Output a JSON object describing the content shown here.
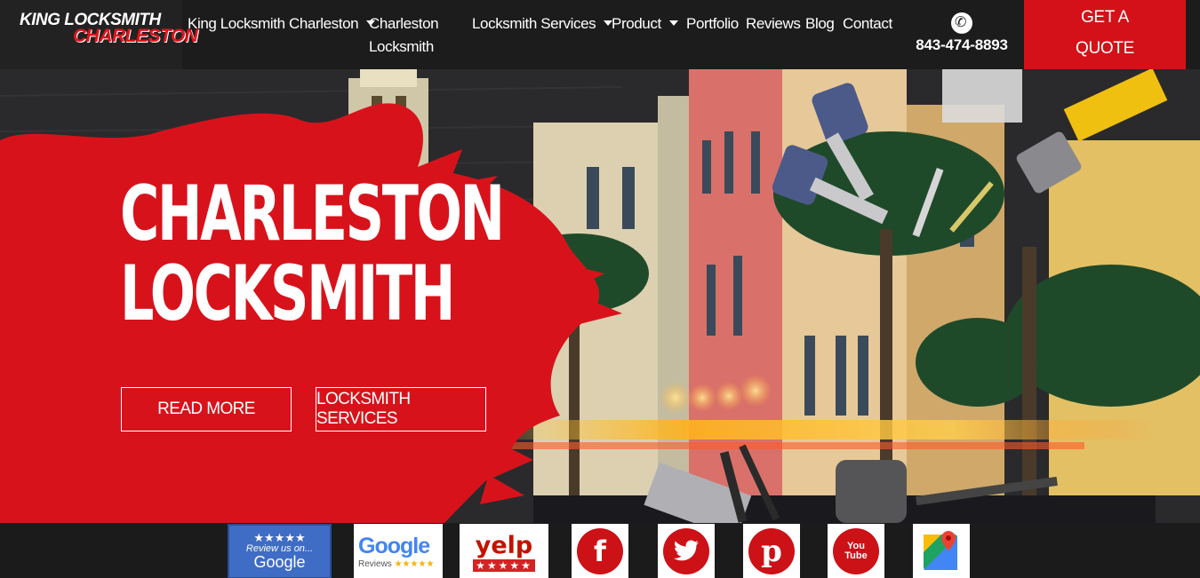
{
  "brand": {
    "line1": "King Locksmith",
    "line2": "Charleston"
  },
  "nav": [
    {
      "label": "King Locksmith Charleston",
      "dropdown": true
    },
    {
      "label": "Charleston",
      "label2": "Locksmith",
      "dropdown": false
    },
    {
      "label": "Locksmith Services",
      "dropdown": true
    },
    {
      "label": "Product",
      "dropdown": true
    },
    {
      "label": "Portfolio",
      "dropdown": false
    },
    {
      "label": "Reviews",
      "dropdown": false
    },
    {
      "label": "Blog",
      "dropdown": false
    },
    {
      "label": "Contact",
      "dropdown": false
    }
  ],
  "phone": {
    "icon": "phone-icon",
    "number": "843-474-8893"
  },
  "quote": {
    "line1": "Get a",
    "line2": "Quote"
  },
  "hero": {
    "title_line1": "CHARLESTON",
    "title_line2": "LOCKSMITH",
    "buttons": [
      "READ MORE",
      "LOCKSMITH SERVICES"
    ]
  },
  "badges": {
    "google_review": {
      "stars": "★★★★★",
      "line1": "Review us on...",
      "line2": "Google"
    },
    "google_reviews": {
      "word": "Google",
      "sub": "Reviews",
      "stars": "★★★★★"
    },
    "yelp": {
      "word": "yelp",
      "stars": "★★★★★"
    },
    "social": [
      "facebook-icon",
      "twitter-icon",
      "pinterest-icon",
      "youtube-icon",
      "google-maps-icon"
    ],
    "youtube_label": "You Tube"
  },
  "colors": {
    "accent": "#d41119",
    "header_bg": "#1c1c1c",
    "text": "#ffffff"
  }
}
